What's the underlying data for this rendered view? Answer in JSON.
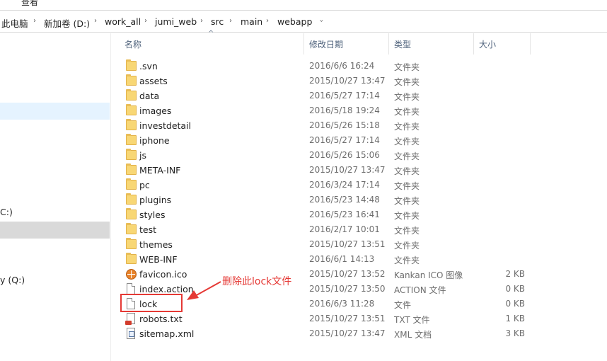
{
  "menubar": {
    "view_label": "查看"
  },
  "breadcrumb": [
    "此电脑",
    "新加卷 (D:)",
    "work_all",
    "jumi_web",
    "src",
    "main",
    "webapp"
  ],
  "nav": {
    "drive_c_fragment": "C:)",
    "drive_q_fragment": "y (Q:)"
  },
  "columns": {
    "name": "名称",
    "date": "修改日期",
    "type": "类型",
    "size": "大小"
  },
  "files": [
    {
      "name": ".svn",
      "date": "2016/6/6 16:24",
      "type": "文件夹",
      "size": "",
      "icon": "folder-icon"
    },
    {
      "name": "assets",
      "date": "2015/10/27 13:47",
      "type": "文件夹",
      "size": "",
      "icon": "folder-icon"
    },
    {
      "name": "data",
      "date": "2016/5/27 17:14",
      "type": "文件夹",
      "size": "",
      "icon": "folder-icon"
    },
    {
      "name": "images",
      "date": "2016/5/18 19:24",
      "type": "文件夹",
      "size": "",
      "icon": "folder-icon"
    },
    {
      "name": "investdetail",
      "date": "2016/5/26 15:18",
      "type": "文件夹",
      "size": "",
      "icon": "folder-icon"
    },
    {
      "name": "iphone",
      "date": "2016/5/27 17:14",
      "type": "文件夹",
      "size": "",
      "icon": "folder-icon"
    },
    {
      "name": "js",
      "date": "2016/5/26 15:06",
      "type": "文件夹",
      "size": "",
      "icon": "folder-icon"
    },
    {
      "name": "META-INF",
      "date": "2015/10/27 13:47",
      "type": "文件夹",
      "size": "",
      "icon": "folder-icon"
    },
    {
      "name": "pc",
      "date": "2016/3/24 17:14",
      "type": "文件夹",
      "size": "",
      "icon": "folder-icon"
    },
    {
      "name": "plugins",
      "date": "2016/5/23 14:48",
      "type": "文件夹",
      "size": "",
      "icon": "folder-icon"
    },
    {
      "name": "styles",
      "date": "2016/5/23 16:41",
      "type": "文件夹",
      "size": "",
      "icon": "folder-icon"
    },
    {
      "name": "test",
      "date": "2016/2/17 10:01",
      "type": "文件夹",
      "size": "",
      "icon": "folder-icon"
    },
    {
      "name": "themes",
      "date": "2015/10/27 13:51",
      "type": "文件夹",
      "size": "",
      "icon": "folder-icon"
    },
    {
      "name": "WEB-INF",
      "date": "2016/6/1 14:13",
      "type": "文件夹",
      "size": "",
      "icon": "folder-icon"
    },
    {
      "name": "favicon.ico",
      "date": "2015/10/27 13:52",
      "type": "Kankan ICO 图像",
      "size": "2 KB",
      "icon": "ico-file-icon"
    },
    {
      "name": "index.action",
      "date": "2015/10/27 13:50",
      "type": "ACTION 文件",
      "size": "0 KB",
      "icon": "file-icon"
    },
    {
      "name": "lock",
      "date": "2016/6/3 11:28",
      "type": "文件",
      "size": "0 KB",
      "icon": "file-icon"
    },
    {
      "name": "robots.txt",
      "date": "2015/10/27 13:51",
      "type": "TXT 文件",
      "size": "1 KB",
      "icon": "txt-file-icon"
    },
    {
      "name": "sitemap.xml",
      "date": "2015/10/27 13:47",
      "type": "XML 文档",
      "size": "3 KB",
      "icon": "xml-file-icon"
    }
  ],
  "annotation": {
    "text": "删除此lock文件",
    "color": "#e53935"
  }
}
